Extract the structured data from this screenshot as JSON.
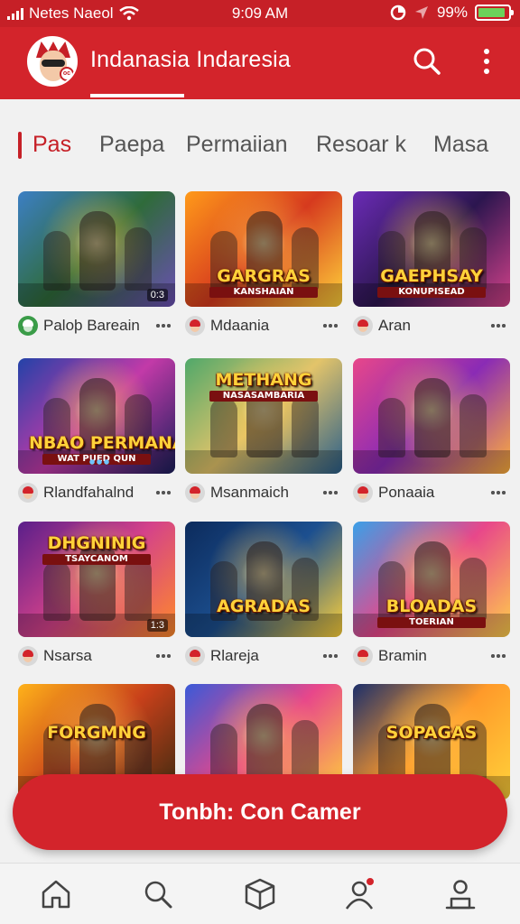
{
  "status_bar": {
    "carrier": "Netes Naeol",
    "time": "9:09 AM",
    "battery": "99%"
  },
  "app_bar": {
    "title": "Indanasia Indaresia",
    "avatar_badge": "oc"
  },
  "tabs": [
    {
      "label": "Pas",
      "active": true
    },
    {
      "label": "Paepa",
      "active": false
    },
    {
      "label": "Permaiian",
      "active": false
    },
    {
      "label": "Resoar k",
      "active": false
    },
    {
      "label": "Masa",
      "active": false
    }
  ],
  "games": [
    {
      "logo": "",
      "sub": "",
      "corner": "0:3",
      "author": "Paloþ Bareain",
      "user_icon": "green",
      "colors": [
        "#3c7fc4",
        "#2f6b3a",
        "#6b4fb4"
      ]
    },
    {
      "logo": "GARGRAS",
      "sub": "KANSHAIAN",
      "corner": "",
      "author": "Mdaania",
      "user_icon": "red",
      "colors": [
        "#ff9a1a",
        "#d63a1e",
        "#ffd23a"
      ]
    },
    {
      "logo": "GAEPHSAY",
      "sub": "KONUPISEAD",
      "corner": "",
      "author": "Aran",
      "user_icon": "red",
      "colors": [
        "#6a2bb5",
        "#2c164f",
        "#d4428a"
      ]
    },
    {
      "logo": "NBAO PERMANA",
      "sub": "WAT PUED QUN",
      "corner": "",
      "author": "Rlandfahalnd",
      "user_icon": "red",
      "colors": [
        "#2342a8",
        "#c23aa8",
        "#1b1f5c"
      ]
    },
    {
      "logo": "METHANG",
      "sub": "NASASAMBARIA",
      "corner": "",
      "author": "Msanmaich",
      "user_icon": "red",
      "colors": [
        "#4fa86a",
        "#e3c46a",
        "#2a5f8a"
      ]
    },
    {
      "logo": "",
      "sub": "",
      "corner": "",
      "author": "Ponaaia",
      "user_icon": "red",
      "colors": [
        "#e8478a",
        "#8a2bb5",
        "#ffb03a"
      ]
    },
    {
      "logo": "DHGNINIG",
      "sub": "TSAYCANOM",
      "corner": "1:3",
      "author": "Nsarsa",
      "user_icon": "red",
      "colors": [
        "#5a1f8a",
        "#d4428a",
        "#ff8a2a"
      ]
    },
    {
      "logo": "AGRADAS",
      "sub": "",
      "corner": "",
      "author": "Rlareja",
      "user_icon": "red",
      "colors": [
        "#0c2b5c",
        "#1c4f8f",
        "#ffd23a"
      ]
    },
    {
      "logo": "BLOADAS",
      "sub": "TOERIAN",
      "corner": "",
      "author": "Bramin",
      "user_icon": "red",
      "colors": [
        "#3aa0e8",
        "#e8478a",
        "#ffcf4a"
      ]
    },
    {
      "logo": "FORGMNG",
      "sub": "",
      "corner": "",
      "author": "",
      "user_icon": "red",
      "colors": [
        "#ffb21a",
        "#c8401a",
        "#3a2a10"
      ]
    },
    {
      "logo": "",
      "sub": "",
      "corner": "",
      "author": "",
      "user_icon": "red",
      "colors": [
        "#3a5ad8",
        "#e8478a",
        "#ffd23a"
      ]
    },
    {
      "logo": "SOPAGAS",
      "sub": "",
      "corner": "",
      "author": "",
      "user_icon": "red",
      "colors": [
        "#1c2f6a",
        "#ff9a2a",
        "#ffd23a"
      ]
    }
  ],
  "cta": {
    "label": "Tonbh: Con Camer"
  },
  "bottom_nav": [
    {
      "icon": "home-icon",
      "badge": false
    },
    {
      "icon": "search-icon",
      "badge": false
    },
    {
      "icon": "box-icon",
      "badge": false
    },
    {
      "icon": "profile-icon",
      "badge": true
    },
    {
      "icon": "account-icon",
      "badge": false
    }
  ],
  "colors": {
    "accent": "#d3242b",
    "background": "#f1f1f1"
  }
}
